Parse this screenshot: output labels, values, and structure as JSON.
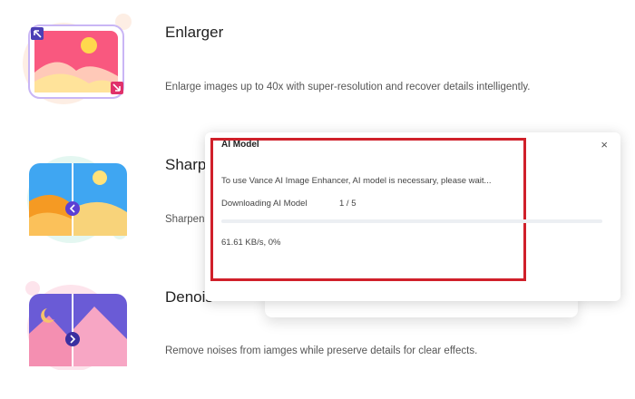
{
  "features": [
    {
      "title": "Enlarger",
      "description": "Enlarge images up to 40x with super-resolution and recover details intelligently."
    },
    {
      "title": "Sharpe",
      "description": "Sharpen"
    },
    {
      "title": "Denois",
      "description": "Remove noises from iamges while preserve details for clear effects."
    }
  ],
  "dialog": {
    "title": "AI Model",
    "close_glyph": "×",
    "message": "To use Vance AI Image Enhancer, AI model is necessary, please wait...",
    "download_label": "Downloading AI Model",
    "download_count": "1 / 5",
    "speed_text": "61.61 KB/s,  0%",
    "progress_fraction": 0
  },
  "colors": {
    "highlight": "#d0202a",
    "enlarger_pink": "#f7567c",
    "enlarger_yellow": "#ffd74d",
    "sharpen_blue": "#3fa6f2",
    "sharpen_orange": "#f59a23",
    "denoise_purple": "#6a5bd6",
    "denoise_pink": "#f48fb1"
  }
}
